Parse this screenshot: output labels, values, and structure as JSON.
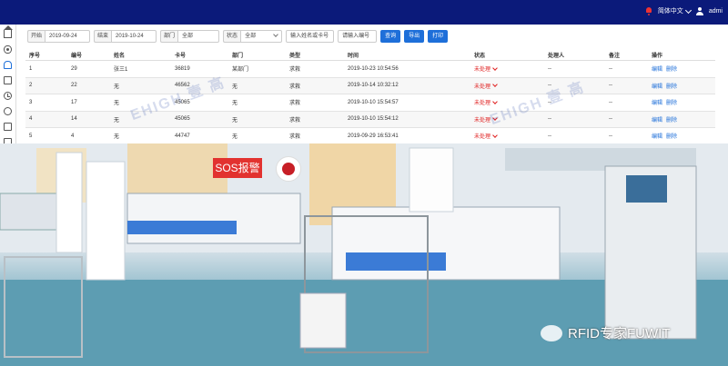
{
  "topbar": {
    "language": "简体中文",
    "user": "admi"
  },
  "filters": {
    "start_label": "开始",
    "start_value": "2019-09-24",
    "end_label": "结束",
    "end_value": "2019-10-24",
    "dept_label": "部门",
    "dept_value": "全部",
    "status_label": "状态",
    "status_value": "全部",
    "search_placeholder": "输入姓名或卡号",
    "number_placeholder": "请输入编号",
    "query_button": "查询",
    "export_button": "导出",
    "print_button": "打印"
  },
  "table": {
    "headers": [
      "序号",
      "编号",
      "姓名",
      "卡号",
      "部门",
      "类型",
      "时间",
      "状态",
      "处理人",
      "备注",
      "操作"
    ],
    "rows": [
      [
        "1",
        "29",
        "张三1",
        "36819",
        "某部门",
        "求救",
        "2019-10-23 10:54:56",
        "未处理",
        "--",
        "--"
      ],
      [
        "2",
        "22",
        "无",
        "46562",
        "无",
        "求救",
        "2019-10-14 10:32:12",
        "未处理",
        "--",
        "--"
      ],
      [
        "3",
        "17",
        "无",
        "45065",
        "无",
        "求救",
        "2019-10-10 15:54:57",
        "未处理",
        "--",
        "--"
      ],
      [
        "4",
        "14",
        "无",
        "45065",
        "无",
        "求救",
        "2019-10-10 15:54:12",
        "未处理",
        "--",
        "--"
      ],
      [
        "5",
        "4",
        "无",
        "44747",
        "无",
        "求救",
        "2019-09-29 16:53:41",
        "未处理",
        "--",
        "--"
      ]
    ],
    "actions": {
      "edit": "编辑",
      "delete": "删除"
    }
  },
  "watermark": "EHIGH 壹 高",
  "photo": {
    "sos_label": "SOS报警",
    "brand_caption": "RFID专家FUWIT"
  },
  "colors": {
    "topbar": "#0b1a7a",
    "accent": "#1e6fd9",
    "status_red": "#e02020",
    "sos_bg": "#e2322f"
  }
}
